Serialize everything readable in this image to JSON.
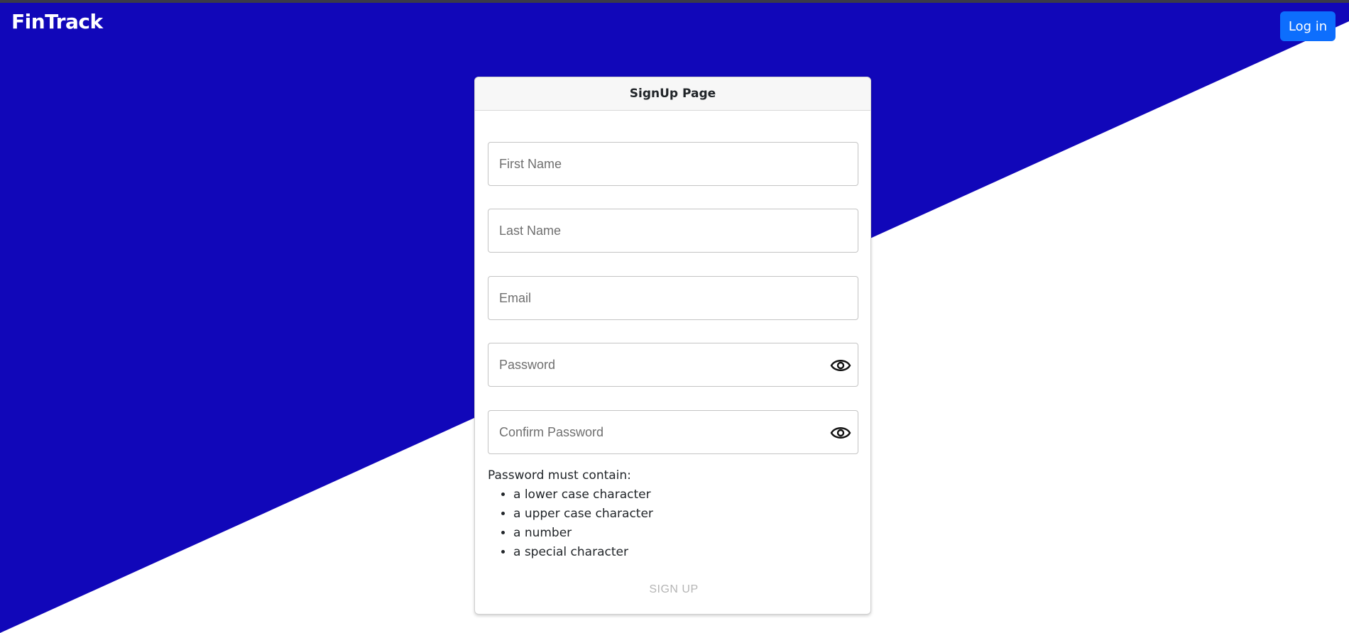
{
  "app": {
    "brand": "FinTrack",
    "login_label": "Log in"
  },
  "colors": {
    "primary_bg": "#1107b9",
    "login_button": "#0d6efd",
    "disabled_text": "#b5b5b5"
  },
  "signup": {
    "title": "SignUp Page",
    "fields": {
      "first_name_placeholder": "First Name",
      "last_name_placeholder": "Last Name",
      "email_placeholder": "Email",
      "password_placeholder": "Password",
      "confirm_password_placeholder": "Confirm Password"
    },
    "icons": {
      "password_toggle": "eye-icon",
      "confirm_password_toggle": "eye-icon"
    },
    "rules": {
      "heading": "Password must contain:",
      "items": [
        "a lower case character",
        "a upper case character",
        "a number",
        "a special character"
      ]
    },
    "submit_label": "SIGN UP"
  }
}
